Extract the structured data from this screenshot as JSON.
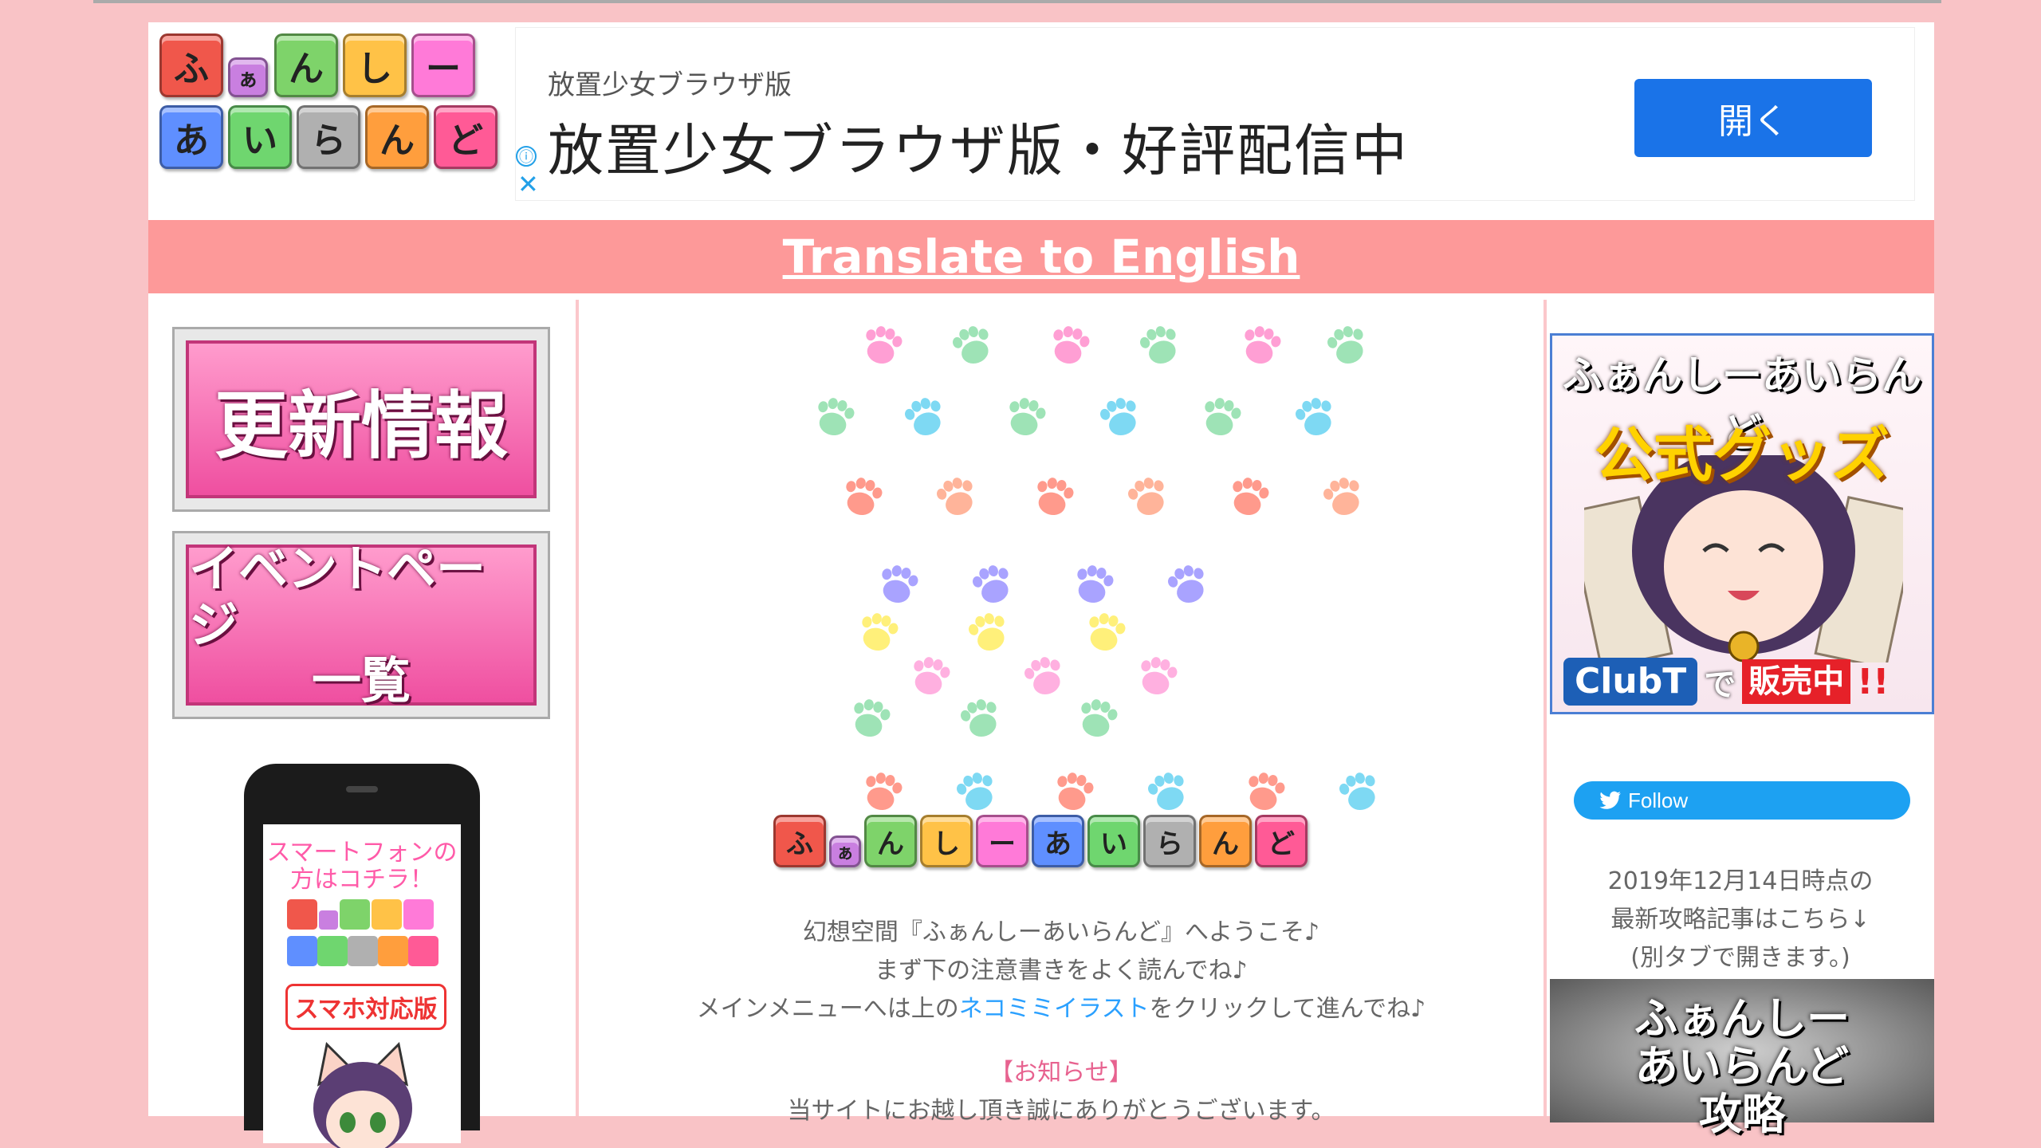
{
  "site": {
    "logo_chars": [
      "ふ",
      "ぁ",
      "ん",
      "し",
      "ー",
      "あ",
      "い",
      "ら",
      "ん",
      "ど"
    ]
  },
  "ad": {
    "subtitle": "放置少女ブラウザ版",
    "title": "放置少女ブラウザ版・好評配信中",
    "info_icon": "ⓘ",
    "close_icon": "✕",
    "open_button": "開く"
  },
  "translate": {
    "link": "Translate to English"
  },
  "left_menu": {
    "update_button": "更新情報",
    "event_button_line1": "イベントページ",
    "event_button_line2": "一覧",
    "smartphone_line1": "スマートフォンの",
    "smartphone_line2": "方はコチラ！",
    "smartphone_badge": "スマホ対応版"
  },
  "center": {
    "line1": "幻想空間『ふぁんしーあいらんど』へようこそ♪",
    "line2": "まず下の注意書きをよく読んでね♪",
    "line3_a": "メインメニューへは上の",
    "line3_link": "ネコミミイラスト",
    "line3_b": "をクリックして進んでね♪",
    "notice_label": "【お知らせ】",
    "line4": "当サイトにお越し頂き誠にありがとうございます。"
  },
  "right": {
    "goods_title1": "ふぁんしーあいらんど",
    "goods_title2": "公式グッズ",
    "goods_clubt": "ClubT",
    "goods_de": "で",
    "goods_hanbai": "販売中",
    "goods_excl": "!!",
    "follow_label": "Follow",
    "note_line1": "2019年12月14日時点の",
    "note_line2": "最新攻略記事はこちら↓",
    "note_line3": "(別タブで開きます。)",
    "banner_line1": "ふぁんしー",
    "banner_line2": "あいらんど",
    "banner_line3": "攻略"
  },
  "colors": {
    "tiles": [
      "#f0574b",
      "#c97fe0",
      "#7ed36a",
      "#ffc247",
      "#ff7ad8",
      "#5f8fff",
      "#6fd66f",
      "#b0b0b0",
      "#ff9e3d",
      "#ff5a96"
    ],
    "paws": [
      "#ff9fd4",
      "#9ee3b6",
      "#7ed9f3",
      "#ff9a8c",
      "#ffb49a",
      "#a9a3ff",
      "#fff07a",
      "#ffb0e0"
    ]
  }
}
